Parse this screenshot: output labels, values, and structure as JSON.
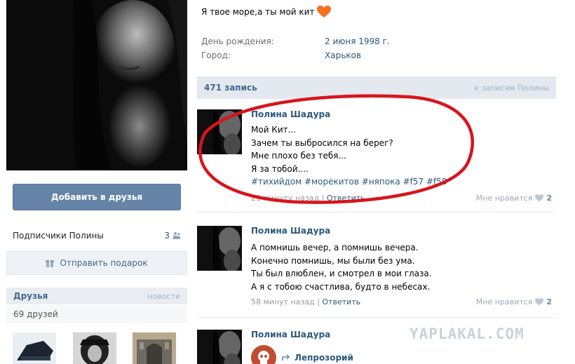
{
  "status": {
    "text": "Я твое море,а ты мой кит",
    "emoji_icon": "heart-icon",
    "emoji_color": "#f37021"
  },
  "info": [
    {
      "label": "День рождения:",
      "value": "2 июня 1998 г."
    },
    {
      "label": "Город:",
      "value": "Харьков"
    }
  ],
  "left": {
    "add_friend_label": "Добавить в друзья",
    "subscribers_label": "Подписчики Полины",
    "subscribers_count": "3",
    "gift_label": "Отправить подарок",
    "friends_title": "Друзья",
    "friends_news": "новости",
    "friends_count": "69 друзей"
  },
  "wall": {
    "posts_count": "471 запись",
    "to_posts_link": "к записям Полины"
  },
  "posts": [
    {
      "author": "Полина Шадура",
      "lines": [
        "Мой Кит...",
        "Зачем ты выбросился на берег?",
        "Мне плохо без тебя...",
        "Я за тобой...."
      ],
      "hashtags": "#тихийдом #морекитов #няпока #f57 #f58",
      "time": "21 минуту назад",
      "reply": "Ответить",
      "like_label": "Мне нравится",
      "likes": "2"
    },
    {
      "author": "Полина Шадура",
      "lines": [
        "А помнишь вечер, а помнишь вечера.",
        "Конечно помнишь, мы были без ума.",
        "Ты был влюблен, и смотрел в мои глаза.",
        "А я с тобою счастлива, будто в небесах."
      ],
      "time": "58 минут назад",
      "reply": "Ответить",
      "like_label": "Мне нравится",
      "likes": "2"
    },
    {
      "author": "Полина Шадура",
      "repost_label": "Лепрозорий"
    }
  ],
  "watermark": "YAPLAKAL.COM",
  "colors": {
    "link": "#2b587a",
    "button": "#6584a8",
    "annotation": "#d8141c"
  }
}
